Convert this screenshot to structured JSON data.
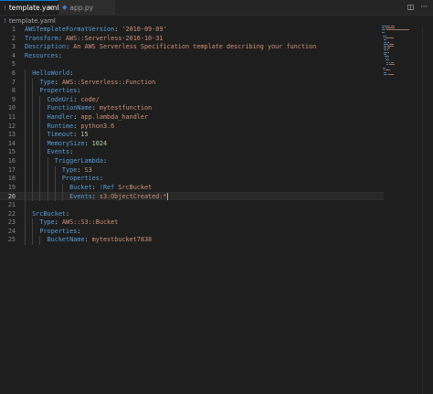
{
  "tabs": [
    {
      "label": "template.yaml",
      "icon": "yaml-icon",
      "active": true
    },
    {
      "label": "app.py",
      "icon": "python-icon",
      "active": false
    }
  ],
  "breadcrumb": {
    "file": "template.yaml"
  },
  "editor": {
    "current_line": 20,
    "lines": [
      {
        "n": "1",
        "parts": [
          [
            "k",
            "AWSTemplateFormatVersion"
          ],
          [
            "p",
            ": "
          ],
          [
            "s",
            "'2010-09-09'"
          ]
        ]
      },
      {
        "n": "2",
        "parts": [
          [
            "k",
            "Transform"
          ],
          [
            "p",
            ": "
          ],
          [
            "s",
            "AWS::Serverless-2016-10-31"
          ]
        ]
      },
      {
        "n": "3",
        "parts": [
          [
            "k",
            "Description"
          ],
          [
            "p",
            ": "
          ],
          [
            "s",
            "An AWS Serverless Specification template describing your function"
          ]
        ]
      },
      {
        "n": "4",
        "parts": [
          [
            "k",
            "Resources"
          ],
          [
            "p",
            ":"
          ]
        ]
      },
      {
        "n": "5",
        "parts": []
      },
      {
        "n": "6",
        "parts": [
          [
            "i",
            "  "
          ],
          [
            "k",
            "HelloWorld"
          ],
          [
            "p",
            ":"
          ]
        ]
      },
      {
        "n": "7",
        "parts": [
          [
            "i",
            "    "
          ],
          [
            "k",
            "Type"
          ],
          [
            "p",
            ": "
          ],
          [
            "s",
            "AWS::Serverless::Function"
          ]
        ]
      },
      {
        "n": "8",
        "parts": [
          [
            "i",
            "    "
          ],
          [
            "k",
            "Properties"
          ],
          [
            "p",
            ":"
          ]
        ]
      },
      {
        "n": "9",
        "parts": [
          [
            "i",
            "      "
          ],
          [
            "k",
            "CodeUri"
          ],
          [
            "p",
            ": "
          ],
          [
            "s",
            "code/"
          ]
        ]
      },
      {
        "n": "10",
        "parts": [
          [
            "i",
            "      "
          ],
          [
            "k",
            "FunctionName"
          ],
          [
            "p",
            ": "
          ],
          [
            "s",
            "mytestfunction"
          ]
        ]
      },
      {
        "n": "11",
        "parts": [
          [
            "i",
            "      "
          ],
          [
            "k",
            "Handler"
          ],
          [
            "p",
            ": "
          ],
          [
            "s",
            "app.lambda_handler"
          ]
        ]
      },
      {
        "n": "12",
        "parts": [
          [
            "i",
            "      "
          ],
          [
            "k",
            "Runtime"
          ],
          [
            "p",
            ": "
          ],
          [
            "s",
            "python3.6"
          ]
        ]
      },
      {
        "n": "13",
        "parts": [
          [
            "i",
            "      "
          ],
          [
            "k",
            "Timeout"
          ],
          [
            "p",
            ": "
          ],
          [
            "n",
            "15"
          ]
        ]
      },
      {
        "n": "14",
        "parts": [
          [
            "i",
            "      "
          ],
          [
            "k",
            "MemorySize"
          ],
          [
            "p",
            ": "
          ],
          [
            "n",
            "1024"
          ]
        ]
      },
      {
        "n": "15",
        "parts": [
          [
            "i",
            "      "
          ],
          [
            "k",
            "Events"
          ],
          [
            "p",
            ":"
          ]
        ]
      },
      {
        "n": "16",
        "parts": [
          [
            "i",
            "        "
          ],
          [
            "k",
            "TriggerLambda"
          ],
          [
            "p",
            ":"
          ]
        ]
      },
      {
        "n": "17",
        "parts": [
          [
            "i",
            "          "
          ],
          [
            "k",
            "Type"
          ],
          [
            "p",
            ": "
          ],
          [
            "s",
            "S3"
          ]
        ]
      },
      {
        "n": "18",
        "parts": [
          [
            "i",
            "          "
          ],
          [
            "k",
            "Properties"
          ],
          [
            "p",
            ":"
          ]
        ]
      },
      {
        "n": "19",
        "parts": [
          [
            "i",
            "            "
          ],
          [
            "k",
            "Bucket"
          ],
          [
            "p",
            ": "
          ],
          [
            "t",
            "!Ref"
          ],
          [
            "p",
            " "
          ],
          [
            "s",
            "SrcBucket"
          ]
        ]
      },
      {
        "n": "20",
        "parts": [
          [
            "i",
            "            "
          ],
          [
            "k",
            "Events"
          ],
          [
            "p",
            ": "
          ],
          [
            "s",
            "s3:ObjectCreated:*"
          ]
        ]
      },
      {
        "n": "21",
        "parts": []
      },
      {
        "n": "22",
        "parts": [
          [
            "i",
            "  "
          ],
          [
            "k",
            "SrcBucket"
          ],
          [
            "p",
            ":"
          ]
        ]
      },
      {
        "n": "23",
        "parts": [
          [
            "i",
            "    "
          ],
          [
            "k",
            "Type"
          ],
          [
            "p",
            ": "
          ],
          [
            "s",
            "AWS::S3::Bucket"
          ]
        ]
      },
      {
        "n": "24",
        "parts": [
          [
            "i",
            "    "
          ],
          [
            "k",
            "Properties"
          ],
          [
            "p",
            ":"
          ]
        ]
      },
      {
        "n": "25",
        "parts": [
          [
            "i",
            "      "
          ],
          [
            "k",
            "BucketName"
          ],
          [
            "p",
            ": "
          ],
          [
            "s",
            "mytestbucket7838"
          ]
        ]
      }
    ]
  },
  "colors": {
    "key": "#569cd6",
    "string": "#ce9178",
    "number": "#b5cea8",
    "accent": "#007acc"
  }
}
